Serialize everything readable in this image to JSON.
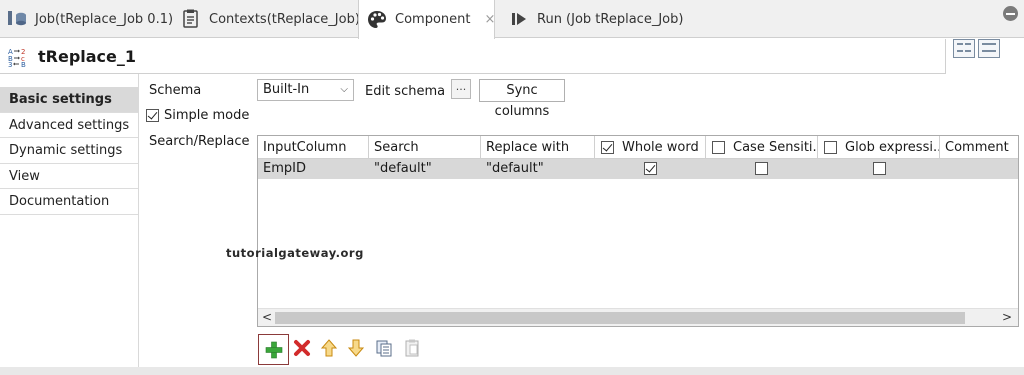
{
  "tabs": [
    {
      "label": "Job(tReplace_Job 0.1)",
      "icon": "job-icon"
    },
    {
      "label": "Contexts(tReplace_Job)",
      "icon": "contexts-icon"
    },
    {
      "label": "Component",
      "icon": "component-palette-icon",
      "active": true,
      "close": "×"
    },
    {
      "label": "Run (Job tReplace_Job)",
      "icon": "run-icon"
    }
  ],
  "component": {
    "title": "tReplace_1",
    "icon": "replace-component-icon"
  },
  "nav": {
    "items": [
      "Basic settings",
      "Advanced settings",
      "Dynamic settings",
      "View",
      "Documentation"
    ],
    "active_index": 0
  },
  "settings": {
    "schema_label": "Schema",
    "schema_value": "Built-In",
    "edit_schema_label": "Edit schema",
    "ellipsis": "...",
    "sync_columns": "Sync columns",
    "simple_mode_label": "Simple mode",
    "simple_mode_checked": true,
    "search_replace_label": "Search/Replace"
  },
  "table": {
    "columns": [
      "InputColumn",
      "Search",
      "Replace with",
      "Whole word",
      "Case Sensiti...",
      "Glob expressi...",
      "Comment"
    ],
    "header_checks": {
      "whole_word": true,
      "case_sensitive": false,
      "glob": false
    },
    "rows": [
      {
        "input_column": "EmpID",
        "search": "\"default\"",
        "replace_with": "\"default\"",
        "whole_word": true,
        "case_sensitive": false,
        "glob": false,
        "comment": ""
      }
    ],
    "scroll_left": "<",
    "scroll_right": ">"
  },
  "watermark": "tutorialgateway.org",
  "toolbar": [
    "add-row-icon",
    "delete-row-icon",
    "move-up-icon",
    "move-down-icon",
    "copy-icon",
    "paste-icon"
  ],
  "colors": {
    "add": "#3aa63a",
    "delete": "#d22b2b",
    "arrow": "#e6a817",
    "selection": "#d8d8d8"
  }
}
